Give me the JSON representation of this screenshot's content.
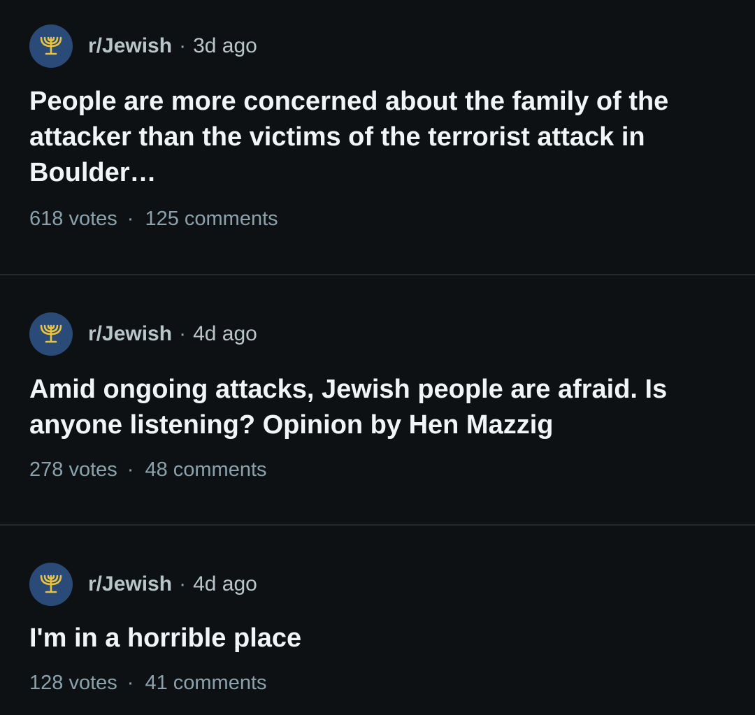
{
  "posts": [
    {
      "subreddit": "r/Jewish",
      "separator": "·",
      "age": "3d ago",
      "title": "People are more concerned about the family of the attacker than the victims of the terrorist attack in Boulder…",
      "votes": "618 votes",
      "comments": "125 comments",
      "avatar_icon": "menorah-icon"
    },
    {
      "subreddit": "r/Jewish",
      "separator": "·",
      "age": "4d ago",
      "title": "Amid ongoing attacks, Jewish people are afraid. Is anyone listening? Opinion by Hen Mazzig",
      "votes": "278 votes",
      "comments": "48 comments",
      "avatar_icon": "menorah-icon"
    },
    {
      "subreddit": "r/Jewish",
      "separator": "·",
      "age": "4d ago",
      "title": "I'm in a horrible place",
      "votes": "128 votes",
      "comments": "41 comments",
      "avatar_icon": "menorah-icon"
    }
  ],
  "stats_separator": "·",
  "colors": {
    "background": "#0e1113",
    "avatar_bg": "#2a4a78",
    "menorah": "#e8c341",
    "title": "#f2f4f5",
    "meta": "#b8c5c9",
    "stats": "#8ba2ad",
    "divider": "#23292d"
  }
}
